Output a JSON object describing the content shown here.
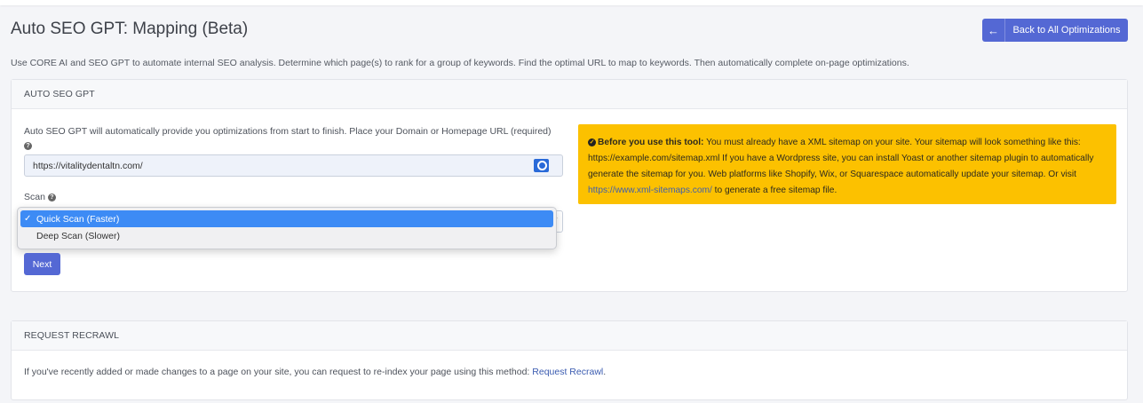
{
  "header": {
    "title": "Auto SEO GPT: Mapping (Beta)",
    "back_label": "Back to All Optimizations",
    "back_icon": "arrow-left-icon",
    "description": "Use CORE AI and SEO GPT to automate internal SEO analysis. Determine which page(s) to rank for a group of keywords. Find the optimal URL to map to keywords. Then automatically complete on-page optimizations."
  },
  "auto_seo_card": {
    "title": "AUTO SEO GPT",
    "url_label": "Auto SEO GPT will automatically provide you optimizations from start to finish. Place your Domain or Homepage URL (required)",
    "url_value": "https://vitalitydentaltn.com/",
    "scan_label": "Scan",
    "scan_options": [
      {
        "label": "Quick Scan (Faster)",
        "selected": true
      },
      {
        "label": "Deep Scan (Slower)",
        "selected": false
      }
    ],
    "next_label": "Next",
    "notice": {
      "lead": "Before you use this tool:",
      "body": " You must already have a XML sitemap on your site. Your sitemap will look something like this: https://example.com/sitemap.xml If you have a Wordpress site, you can install Yoast or another sitemap plugin to automatically generate the sitemap for you. Web platforms like Shopify, Wix, or Squarespace automatically update your sitemap. Or visit ",
      "link": "https://www.xml-sitemaps.com/",
      "tail": " to generate a free sitemap file."
    }
  },
  "recrawl_card": {
    "title": "REQUEST RECRAWL",
    "text": "If you've recently added or made changes to a page on your site, you can request to re-index your page using this method: ",
    "link": "Request Recrawl",
    "tail": "."
  },
  "colors": {
    "primary": "#5468d4",
    "notice": "#fcc100",
    "selected_option": "#3d8bf5"
  }
}
